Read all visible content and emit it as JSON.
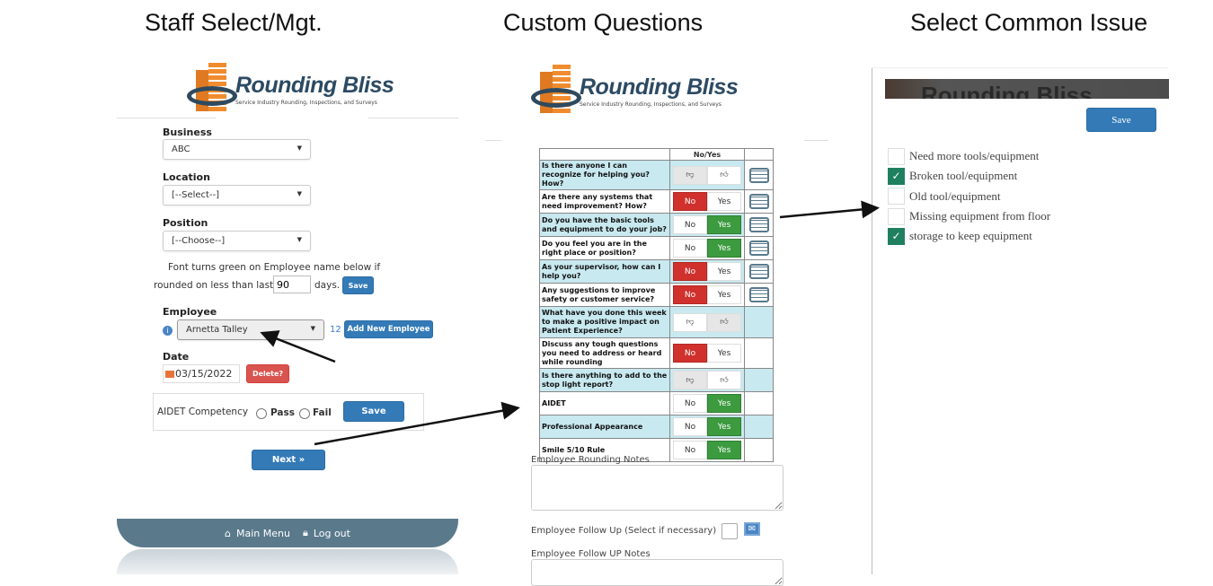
{
  "headings": {
    "staff": "Staff Select/Mgt.",
    "custom": "Custom Questions",
    "issue": "Select Common Issue"
  },
  "logo": {
    "name": "Rounding Bliss",
    "tagline": "Service Industry Rounding, Inspections, and Surveys"
  },
  "staff_form": {
    "business_label": "Business",
    "business_value": "ABC",
    "location_label": "Location",
    "location_value": "[--Select--]",
    "position_label": "Position",
    "position_value": "[--Choose--]",
    "hint_line1": "Font turns green on Employee name below if",
    "hint_line2_prefix": "rounded on less than last",
    "days_value": "90",
    "days_suffix": "days.",
    "days_save": "Save",
    "employee_label": "Employee",
    "employee_value": "Arnetta Talley",
    "employee_count": "12",
    "add_employee": "Add New Employee",
    "date_label": "Date",
    "date_value": "03/15/2022",
    "delete": "Delete?",
    "aidet_label": "AIDET Competency",
    "pass": "Pass",
    "fail": "Fail",
    "aidet_save": "Save",
    "next": "Next »",
    "footer_main_menu": "Main Menu",
    "footer_logout": "Log out"
  },
  "questions": {
    "header": "No/Yes",
    "rows": [
      {
        "text": "Is there anyone I can recognize for helping you? How?",
        "type": "thumb",
        "selected": "down",
        "list": true
      },
      {
        "text": "Are there any systems that need improvement? How?",
        "type": "yesno",
        "selected": "no",
        "list": true
      },
      {
        "text": "Do you have the basic tools and equipment to do your job?",
        "type": "yesno",
        "selected": "yes",
        "list": true
      },
      {
        "text": "Do you feel you are in the right place or position?",
        "type": "yesno",
        "selected": "yes",
        "list": true
      },
      {
        "text": "As your supervisor, how can I help you?",
        "type": "yesno",
        "selected": "no",
        "list": true
      },
      {
        "text": "Any suggestions to improve safety or customer service?",
        "type": "yesno",
        "selected": "no",
        "list": true
      },
      {
        "text": "What have you done this week to make a positive impact on Patient Experience?",
        "type": "thumb",
        "selected": "up",
        "list": false
      },
      {
        "text": "Discuss any tough questions you need to address or heard while rounding",
        "type": "yesno",
        "selected": "no",
        "list": false
      },
      {
        "text": "Is there anything to add to the stop light report?",
        "type": "thumb",
        "selected": "down",
        "list": false
      },
      {
        "text": "AIDET",
        "type": "yesno",
        "selected": "yes",
        "list": false
      },
      {
        "text": "Professional Appearance",
        "type": "yesno",
        "selected": "yes",
        "list": false
      },
      {
        "text": "Smile 5/10 Rule",
        "type": "yesno",
        "selected": "yes",
        "list": false
      }
    ],
    "no_label": "No",
    "yes_label": "Yes",
    "rounding_notes_label": "Employee Rounding Notes",
    "follow_up_label": "Employee Follow Up (Select if necessary)",
    "follow_up_notes_label": "Employee Follow UP Notes"
  },
  "issues": {
    "save": "Save",
    "items": [
      {
        "label": "Need more tools/equipment",
        "checked": false
      },
      {
        "label": "Broken tool/equipment",
        "checked": true
      },
      {
        "label": "Old tool/equipment",
        "checked": false
      },
      {
        "label": "Missing equipment from floor",
        "checked": false
      },
      {
        "label": "storage to keep equipment",
        "checked": true
      }
    ]
  },
  "colors": {
    "primary": "#337ab7",
    "danger": "#d0312d",
    "success": "#3c9a3f",
    "footer": "#5a7a8c",
    "row_alt": "#c8e9f0",
    "checkbox": "#1f8060"
  }
}
